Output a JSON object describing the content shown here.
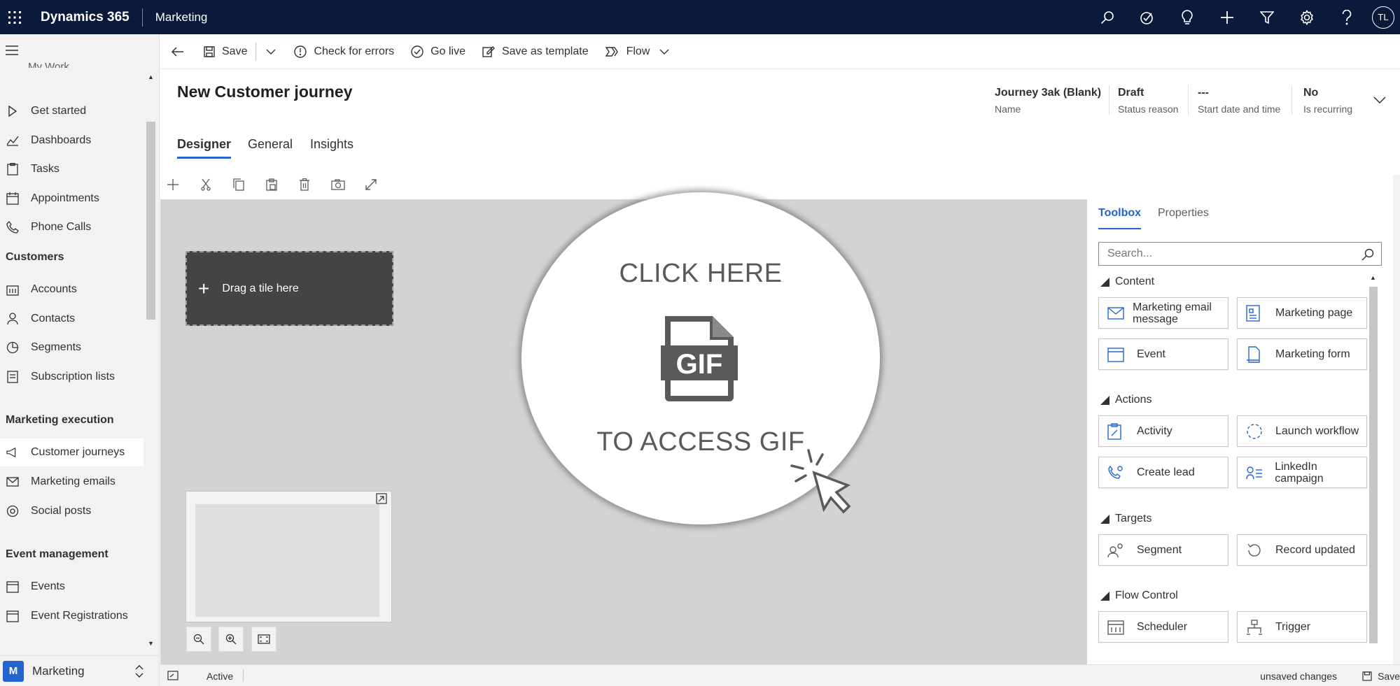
{
  "topbar": {
    "product": "Dynamics 365",
    "area": "Marketing",
    "avatar_initials": "TL",
    "icons": [
      "search-icon",
      "task-flow-icon",
      "lightbulb-icon",
      "plus-icon",
      "filter-icon",
      "gear-icon",
      "help-icon"
    ]
  },
  "sidebar": {
    "cut_label": "My Work",
    "items": [
      {
        "label": "Get started",
        "icon": "play-icon"
      },
      {
        "label": "Dashboards",
        "icon": "dashboard-icon"
      },
      {
        "label": "Tasks",
        "icon": "tasks-icon"
      },
      {
        "label": "Appointments",
        "icon": "calendar-icon"
      },
      {
        "label": "Phone Calls",
        "icon": "phone-icon"
      }
    ],
    "group_customers": "Customers",
    "customers_items": [
      {
        "label": "Accounts",
        "icon": "building-icon"
      },
      {
        "label": "Contacts",
        "icon": "person-icon"
      },
      {
        "label": "Segments",
        "icon": "segment-icon"
      },
      {
        "label": "Subscription lists",
        "icon": "list-icon"
      }
    ],
    "group_execution": "Marketing execution",
    "execution_items": [
      {
        "label": "Customer journeys",
        "icon": "megaphone-icon",
        "active": true
      },
      {
        "label": "Marketing emails",
        "icon": "email-icon"
      },
      {
        "label": "Social posts",
        "icon": "social-icon"
      }
    ],
    "group_events": "Event management",
    "events_items": [
      {
        "label": "Events",
        "icon": "calendar-icon"
      },
      {
        "label": "Event Registrations",
        "icon": "calendar-icon"
      }
    ],
    "area_badge": "M",
    "area_name": "Marketing"
  },
  "commandbar": {
    "save": "Save",
    "check_errors": "Check for errors",
    "go_live": "Go live",
    "save_template": "Save as template",
    "flow": "Flow"
  },
  "header": {
    "title": "New Customer journey",
    "fields": [
      {
        "value": "Journey 3ak (Blank)",
        "label": "Name"
      },
      {
        "value": "Draft",
        "label": "Status reason"
      },
      {
        "value": "---",
        "label": "Start date and time"
      },
      {
        "value": "No",
        "label": "Is recurring"
      }
    ]
  },
  "tabs": [
    "Designer",
    "General",
    "Insights"
  ],
  "canvas": {
    "drag_tile": "Drag a tile here"
  },
  "overlay": {
    "top_text": "CLICK HERE",
    "bottom_text": "TO ACCESS GIF",
    "gif_label": "GIF"
  },
  "toolbox": {
    "tabs": [
      "Toolbox",
      "Properties"
    ],
    "search_placeholder": "Search...",
    "sections": {
      "content": "Content",
      "actions": "Actions",
      "targets": "Targets",
      "flow_control": "Flow Control"
    },
    "tiles": {
      "marketing_email": "Marketing email message",
      "marketing_page": "Marketing page",
      "event": "Event",
      "marketing_form": "Marketing form",
      "activity": "Activity",
      "launch_workflow": "Launch workflow",
      "create_lead": "Create lead",
      "linkedin_campaign": "LinkedIn campaign",
      "segment": "Segment",
      "record_updated": "Record updated",
      "scheduler": "Scheduler",
      "trigger": "Trigger"
    }
  },
  "statusbar": {
    "state": "Active",
    "unsaved": "unsaved changes",
    "save": "Save"
  },
  "colors": {
    "topbar": "#0b1a3a",
    "accent": "#2564cf",
    "canvas": "#d3d3d3"
  }
}
